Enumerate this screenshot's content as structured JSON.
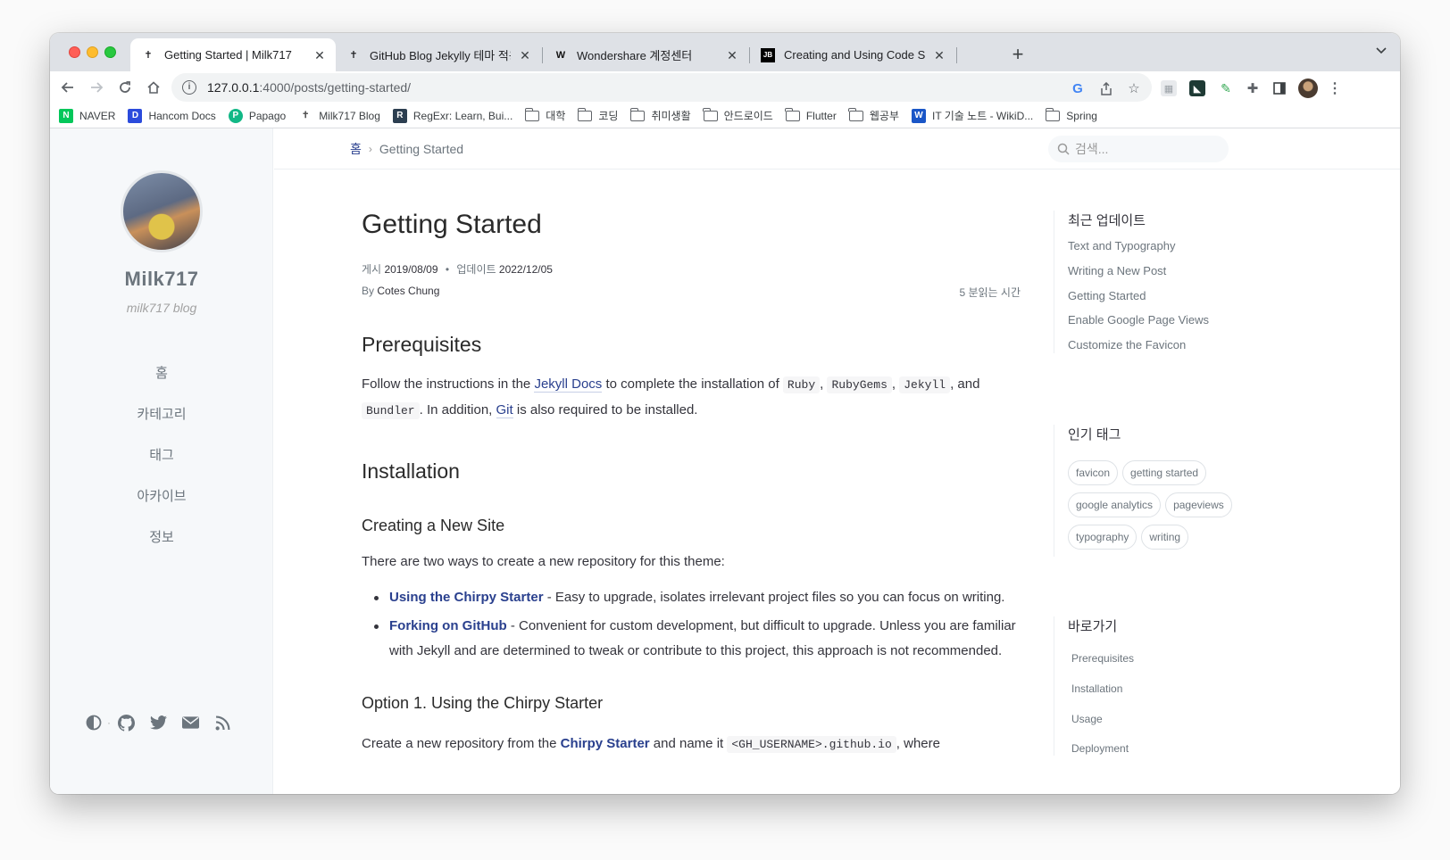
{
  "browser": {
    "tabs": [
      {
        "title": "Getting Started | Milk717",
        "favicon": "jekyll-icon",
        "active": true
      },
      {
        "title": "GitHub Blog Jekylly 테마 적용 시",
        "favicon": "jekyll-icon",
        "active": false
      },
      {
        "title": "Wondershare 계정센터",
        "favicon": "wondershare-icon",
        "active": false
      },
      {
        "title": "Creating and Using Code Snipp",
        "favicon": "jetbrains-icon",
        "active": false
      }
    ],
    "url_host": "127.0.0.1",
    "url_rest": ":4000/posts/getting-started/",
    "bookmarks": [
      {
        "label": "NAVER",
        "icon": "naver-icon",
        "color": "#03c75a",
        "glyph": "N"
      },
      {
        "label": "Hancom Docs",
        "icon": "hancom-icon",
        "color": "#2b4bdc",
        "glyph": "D"
      },
      {
        "label": "Papago",
        "icon": "papago-icon",
        "color": "#12b886",
        "glyph": "P"
      },
      {
        "label": "Milk717 Blog",
        "icon": "jekyll-icon",
        "color": "#ffffff",
        "glyph": "✝"
      },
      {
        "label": "RegExr: Learn, Bui...",
        "icon": "regexr-icon",
        "color": "#2c3e50",
        "glyph": "R"
      },
      {
        "label": "대학",
        "icon": "folder-icon"
      },
      {
        "label": "코딩",
        "icon": "folder-icon"
      },
      {
        "label": "취미생활",
        "icon": "folder-icon"
      },
      {
        "label": "안드로이드",
        "icon": "folder-icon"
      },
      {
        "label": "Flutter",
        "icon": "folder-icon"
      },
      {
        "label": "웹공부",
        "icon": "folder-icon"
      },
      {
        "label": "IT 기술 노트 - WikiD...",
        "icon": "wikidocs-icon",
        "color": "#1a56c7",
        "glyph": "W"
      },
      {
        "label": "Spring",
        "icon": "folder-icon"
      }
    ]
  },
  "sidebar": {
    "title": "Milk717",
    "subtitle": "milk717 blog",
    "nav": [
      "홈",
      "카테고리",
      "태그",
      "아카이브",
      "정보"
    ]
  },
  "topbar": {
    "breadcrumb_home": "홈",
    "breadcrumb_current": "Getting Started",
    "search_placeholder": "검색..."
  },
  "post": {
    "title": "Getting Started",
    "posted_label": "게시",
    "posted_date": "2019/08/09",
    "updated_label": "업데이트",
    "updated_date": "2022/12/05",
    "by_label": "By",
    "author": "Cotes Chung",
    "read_time": "5 분읽는 시간",
    "h_prereq": "Prerequisites",
    "p1_a": "Follow the instructions in the ",
    "p1_link": "Jekyll Docs",
    "p1_b": " to complete the installation of ",
    "code_ruby": "Ruby",
    "code_rubygems": "RubyGems",
    "code_jekyll": "Jekyll",
    "p1_and": ", and",
    "code_bundler": "Bundler",
    "p1_c": ". In addition, ",
    "p1_git": "Git",
    "p1_d": " is also required to be installed.",
    "h_install": "Installation",
    "h_new_site": "Creating a New Site",
    "p2": "There are two ways to create a new repository for this theme:",
    "li1_link": "Using the Chirpy Starter",
    "li1_text": " - Easy to upgrade, isolates irrelevant project files so you can focus on writing.",
    "li2_link": "Forking on GitHub",
    "li2_text": " - Convenient for custom development, but difficult to upgrade. Unless you are familiar with Jekyll and are determined to tweak or contribute to this project, this approach is not recommended.",
    "h_option1": "Option 1. Using the Chirpy Starter",
    "p3_a": "Create a new repository from the ",
    "p3_link": "Chirpy Starter",
    "p3_b": " and name it ",
    "p3_code": "<GH_USERNAME>.github.io",
    "p3_c": ", where"
  },
  "panel": {
    "recent_title": "최근 업데이트",
    "recent": [
      "Text and Typography",
      "Writing a New Post",
      "Getting Started",
      "Enable Google Page Views",
      "Customize the Favicon"
    ],
    "tags_title": "인기 태그",
    "tags": [
      "favicon",
      "getting started",
      "google analytics",
      "pageviews",
      "typography",
      "writing"
    ],
    "toc_title": "바로가기",
    "toc": [
      "Prerequisites",
      "Installation",
      "Usage",
      "Deployment"
    ]
  }
}
